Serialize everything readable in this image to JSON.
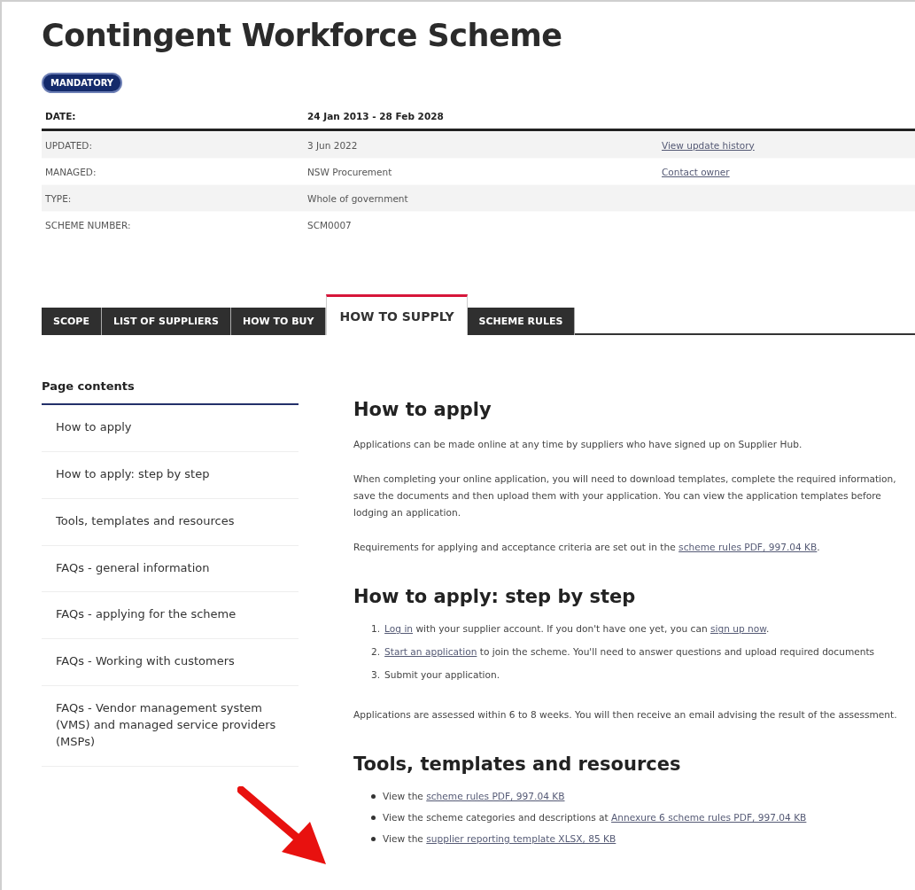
{
  "title": "Contingent Workforce Scheme",
  "badge": "MANDATORY",
  "details": {
    "header": {
      "label": "DATE:",
      "value": "24 Jan 2013 - 28 Feb 2028"
    },
    "rows": [
      {
        "label": "UPDATED:",
        "value": "3 Jun 2022",
        "link": "View update history"
      },
      {
        "label": "MANAGED:",
        "value": "NSW Procurement",
        "link": "Contact owner"
      },
      {
        "label": "TYPE:",
        "value": "Whole of government"
      },
      {
        "label": "SCHEME NUMBER:",
        "value": "SCM0007"
      }
    ]
  },
  "tabs": [
    {
      "label": "SCOPE",
      "selected": false
    },
    {
      "label": "LIST OF SUPPLIERS",
      "selected": false
    },
    {
      "label": "HOW TO BUY",
      "selected": false
    },
    {
      "label": "HOW TO SUPPLY",
      "selected": true
    },
    {
      "label": "SCHEME RULES",
      "selected": false
    }
  ],
  "sidebar": {
    "title": "Page contents",
    "items": [
      "How to apply",
      "How to apply: step by step",
      "Tools, templates and resources",
      "FAQs - general information",
      "FAQs - applying for the scheme",
      "FAQs - Working with customers",
      "FAQs - Vendor management system (VMS) and managed service providers (MSPs)"
    ]
  },
  "sections": [
    {
      "heading": "How to apply",
      "blocks": [
        {
          "kind": "paragraph",
          "parts": [
            {
              "text": "Applications can be made online at any time by suppliers who have signed up on Supplier Hub."
            }
          ]
        },
        {
          "kind": "paragraph",
          "parts": [
            {
              "text": "When completing your online application, you will need to download templates, complete the required information, save the documents and then upload them with your application. You can view the application templates before lodging an application."
            }
          ]
        },
        {
          "kind": "paragraph",
          "parts": [
            {
              "text": "Requirements for applying and acceptance criteria are set out in the "
            },
            {
              "text": "scheme rules PDF, 997.04 KB",
              "link": true
            },
            {
              "text": "."
            }
          ]
        }
      ]
    },
    {
      "heading": "How to apply: step by step",
      "blocks": [
        {
          "kind": "numbered",
          "items": [
            {
              "number": "1.",
              "parts": [
                {
                  "text": "Log in",
                  "link": true
                },
                {
                  "text": " with your supplier account. If you don't have one yet, you can "
                },
                {
                  "text": "sign up now",
                  "link": true
                },
                {
                  "text": "."
                }
              ]
            },
            {
              "number": "2.",
              "parts": [
                {
                  "text": "Start an application",
                  "link": true
                },
                {
                  "text": " to join the scheme. You'll need to answer questions and upload required documents"
                }
              ]
            },
            {
              "number": "3.",
              "parts": [
                {
                  "text": "Submit your application."
                }
              ]
            }
          ]
        },
        {
          "kind": "paragraph",
          "parts": [
            {
              "text": "Applications are assessed within 6 to 8 weeks. You will then receive an email advising the result of the assessment."
            }
          ]
        }
      ]
    },
    {
      "heading": "Tools, templates and resources",
      "blocks": [
        {
          "kind": "bullets",
          "items": [
            {
              "parts": [
                {
                  "text": "View the "
                },
                {
                  "text": "scheme rules PDF, 997.04 KB",
                  "link": true
                }
              ]
            },
            {
              "parts": [
                {
                  "text": "View the scheme categories and descriptions at "
                },
                {
                  "text": "Annexure 6 scheme rules PDF, 997.04 KB",
                  "link": true
                }
              ]
            },
            {
              "parts": [
                {
                  "text": "View the "
                },
                {
                  "text": "supplier reporting template XLSX, 85 KB",
                  "link": true
                }
              ]
            }
          ]
        }
      ]
    }
  ]
}
